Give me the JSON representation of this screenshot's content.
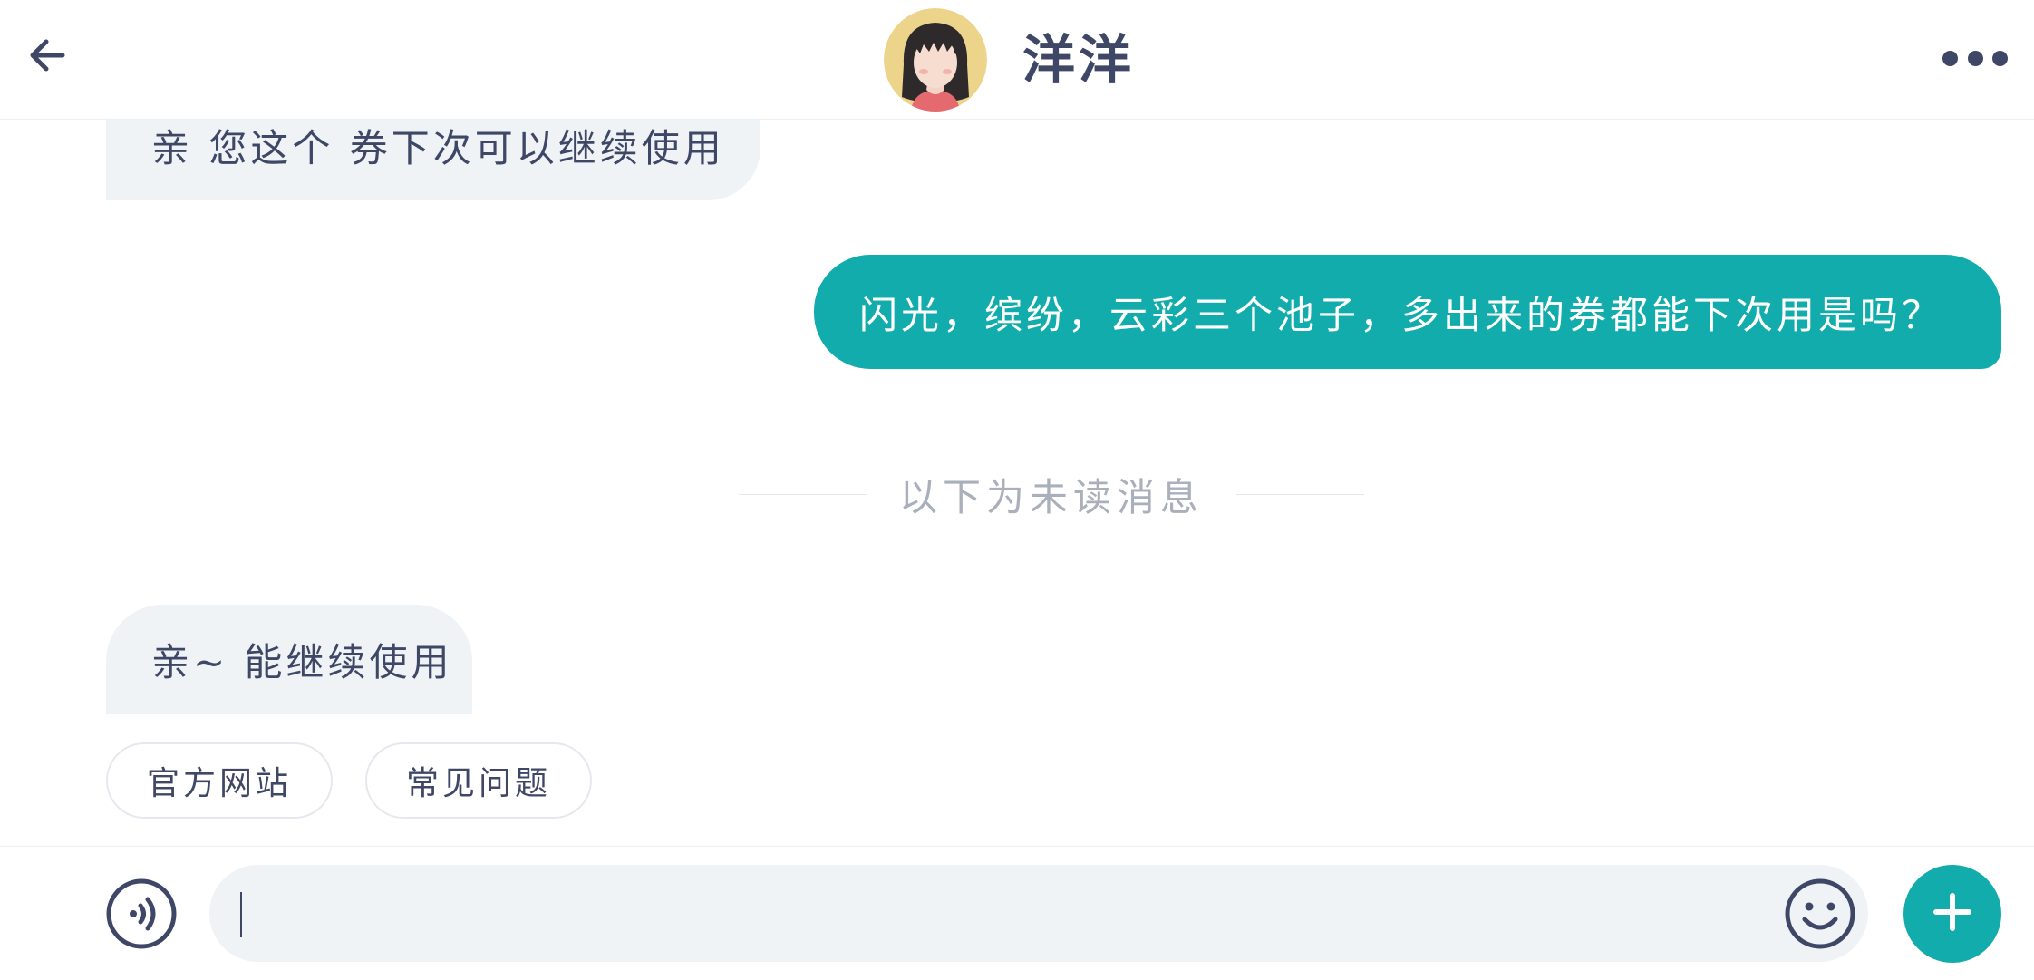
{
  "header": {
    "contact_name": "洋洋",
    "back_icon": "arrow-left-icon",
    "more_icon": "more-dots-icon"
  },
  "messages": [
    {
      "side": "incoming",
      "text": "亲 您这个 券下次可以继续使用"
    },
    {
      "side": "outgoing",
      "text": "闪光，缤纷，云彩三个池子，多出来的券都能下次用是吗？"
    },
    {
      "side": "incoming",
      "text": "亲~ 能继续使用"
    }
  ],
  "divider": {
    "text": "以下为未读消息"
  },
  "quick_replies": [
    {
      "label": "官方网站"
    },
    {
      "label": "常见问题"
    }
  ],
  "input": {
    "value": "",
    "voice_icon": "voice-icon",
    "emoji_icon": "emoji-smile-icon",
    "plus_icon": "plus-icon"
  },
  "colors": {
    "accent": "#11acab",
    "incoming_bubble": "#eff3f6",
    "text": "#3f4766",
    "muted": "#a9b0bc"
  }
}
